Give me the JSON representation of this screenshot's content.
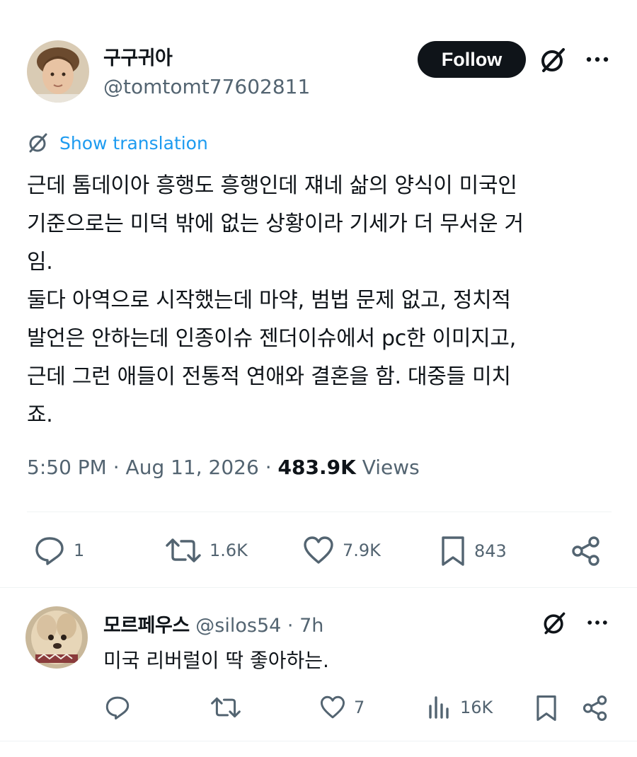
{
  "tweet": {
    "author": {
      "display_name": "구구귀아",
      "handle": "@tomtomt77602811",
      "avatar": "profile-photo"
    },
    "follow_label": "Follow",
    "translate_label": "Show translation",
    "text": "근데 톰데이아 흥행도 흥행인데 쟤네 삶의 양식이 미국인\n기준으로는 미덕 밖에 없는 상황이라 기세가 더 무서운 거\n임.\n둘다 아역으로 시작했는데 마약, 범법 문제 없고, 정치적\n발언은 안하는데 인종이슈 젠더이슈에서 pc한 이미지고,\n근데 그런 애들이 전통적 연애와 결혼을 함. 대중들 미치\n죠.",
    "time": "5:50 PM",
    "date": "Aug 11, 2026",
    "views_count": "483.9K",
    "views_label": "Views",
    "actions": {
      "replies": "1",
      "reposts": "1.6K",
      "likes": "7.9K",
      "bookmarks": "843"
    }
  },
  "reply": {
    "author": {
      "display_name": "모르페우스",
      "handle": "@silos54",
      "time_ago": "7h",
      "avatar": "dog-photo"
    },
    "text": "미국 리버럴이 딱 좋아하는.",
    "actions": {
      "replies": "",
      "reposts": "",
      "likes": "7",
      "views": "16K"
    }
  },
  "icons": {
    "grok": "grok-icon",
    "more": "more-icon",
    "reply": "reply-icon",
    "repost": "repost-icon",
    "like": "heart-icon",
    "bookmark": "bookmark-icon",
    "share": "share-icon",
    "views": "views-icon"
  },
  "colors": {
    "text": "#0f1419",
    "secondary": "#536471",
    "link": "#1d9bf0",
    "button": "#0f1419"
  }
}
